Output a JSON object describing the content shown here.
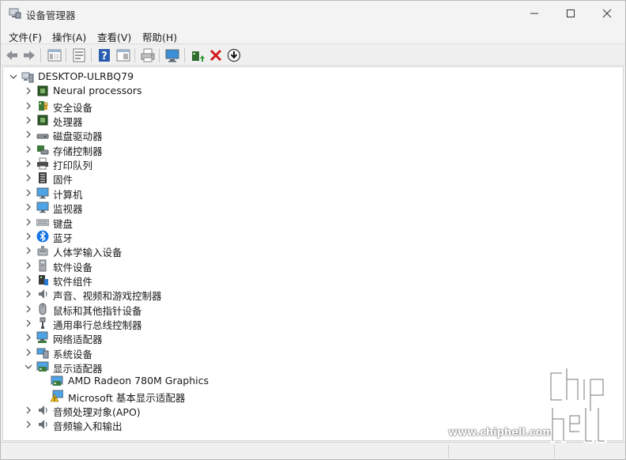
{
  "window": {
    "title": "设备管理器"
  },
  "menu": {
    "items": [
      "文件(F)",
      "操作(A)",
      "查看(V)",
      "帮助(H)"
    ]
  },
  "toolbar": {
    "buttons": [
      "back-arrow-icon",
      "forward-arrow-icon",
      "show-hide-tree-icon",
      "properties-icon",
      "help-icon",
      "view-icon",
      "print-icon",
      "monitor-icon",
      "add-driver-icon",
      "uninstall-icon",
      "update-driver-icon"
    ]
  },
  "tree": {
    "root": "DESKTOP-ULRBQ79",
    "categories": [
      {
        "label": "Neural processors",
        "icon": "chip-icon"
      },
      {
        "label": "安全设备",
        "icon": "security-icon"
      },
      {
        "label": "处理器",
        "icon": "processor-icon"
      },
      {
        "label": "磁盘驱动器",
        "icon": "disk-icon"
      },
      {
        "label": "存储控制器",
        "icon": "storage-controller-icon"
      },
      {
        "label": "打印队列",
        "icon": "printer-icon"
      },
      {
        "label": "固件",
        "icon": "firmware-icon"
      },
      {
        "label": "计算机",
        "icon": "computer-icon"
      },
      {
        "label": "监视器",
        "icon": "monitor-icon"
      },
      {
        "label": "键盘",
        "icon": "keyboard-icon"
      },
      {
        "label": "蓝牙",
        "icon": "bluetooth-icon"
      },
      {
        "label": "人体学输入设备",
        "icon": "hid-icon"
      },
      {
        "label": "软件设备",
        "icon": "software-device-icon"
      },
      {
        "label": "软件组件",
        "icon": "software-component-icon"
      },
      {
        "label": "声音、视频和游戏控制器",
        "icon": "speaker-icon"
      },
      {
        "label": "鼠标和其他指针设备",
        "icon": "mouse-icon"
      },
      {
        "label": "通用串行总线控制器",
        "icon": "usb-icon"
      },
      {
        "label": "网络适配器",
        "icon": "network-icon"
      },
      {
        "label": "系统设备",
        "icon": "system-device-icon"
      },
      {
        "label": "显示适配器",
        "icon": "display-adapter-icon",
        "expanded": true
      },
      {
        "label": "音频处理对象(APO)",
        "icon": "speaker-icon"
      },
      {
        "label": "音频输入和输出",
        "icon": "speaker-icon"
      }
    ],
    "display_children": [
      {
        "label": "AMD Radeon 780M Graphics",
        "icon": "display-adapter-icon"
      },
      {
        "label": "Microsoft 基本显示适配器",
        "icon": "warning-display-icon"
      }
    ]
  },
  "watermark": {
    "url": "www.chiphell.com",
    "logo": "chiphell-logo"
  }
}
